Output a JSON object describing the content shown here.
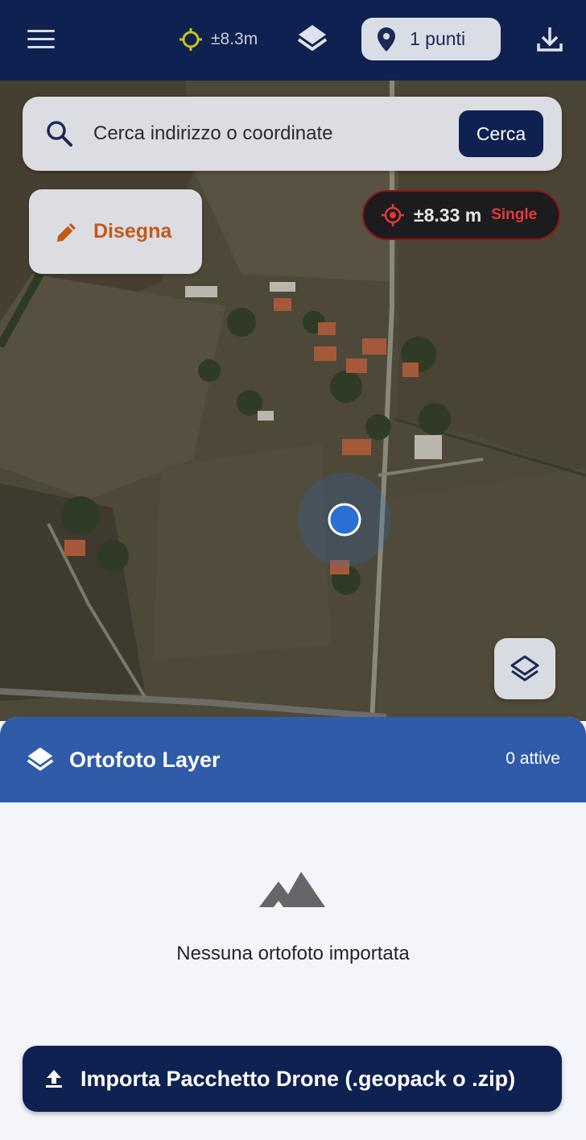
{
  "appbar": {
    "gps_accuracy": "±8.3m",
    "points_label": "1 punti"
  },
  "search": {
    "placeholder": "Cerca indirizzo o coordinate",
    "button_label": "Cerca"
  },
  "draw": {
    "label": "Disegna"
  },
  "accuracy_badge": {
    "value": "±8.33 m",
    "mode": "Single"
  },
  "sheet": {
    "title": "Ortofoto Layer",
    "active_count": "0 attive",
    "empty_message": "Nessuna ortofoto importata",
    "import_label": "Importa Pacchetto Drone (.geopack o .zip)"
  },
  "colors": {
    "appbar": "#0f2150",
    "sheet_header": "#2f5ba8",
    "draw_accent": "#c25a16",
    "gps_icon": "#c8c21e",
    "location_dot": "#2b6fd3"
  },
  "icons": [
    "menu-icon",
    "gps-target-icon",
    "layers-icon",
    "location-pin-icon",
    "download-icon",
    "search-icon",
    "pencil-icon",
    "crosshair-icon",
    "mountain-icon",
    "upload-icon"
  ]
}
